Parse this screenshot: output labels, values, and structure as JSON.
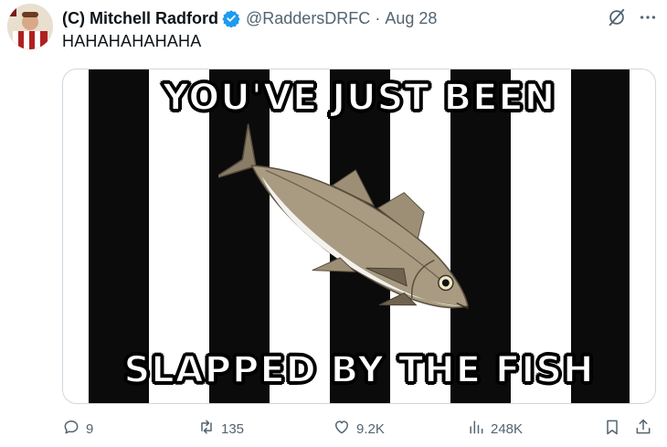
{
  "author": {
    "display_name": "(C) Mitchell Radford",
    "handle": "@RaddersDRFC",
    "separator": "·",
    "date": "Aug 28"
  },
  "tweet": {
    "text": "HAHAHAHAHAHA"
  },
  "media": {
    "top_caption": "YOU'VE JUST BEEN",
    "bottom_caption": "SLAPPED BY THE FISH",
    "stripe_colors": [
      "#0b0b0b",
      "#ffffff"
    ],
    "subject": "fish"
  },
  "actions": {
    "replies": "9",
    "retweets": "135",
    "likes": "9.2K",
    "views": "248K"
  },
  "icons": {
    "verified": "verified-badge-icon",
    "grok": "grok-icon",
    "more": "more-icon",
    "reply": "reply-icon",
    "retweet": "retweet-icon",
    "like": "heart-icon",
    "views": "views-icon",
    "bookmark": "bookmark-icon",
    "share": "share-icon"
  },
  "colors": {
    "verified_blue": "#1d9bf0",
    "secondary_text": "#536471",
    "primary_text": "#0f1419"
  }
}
